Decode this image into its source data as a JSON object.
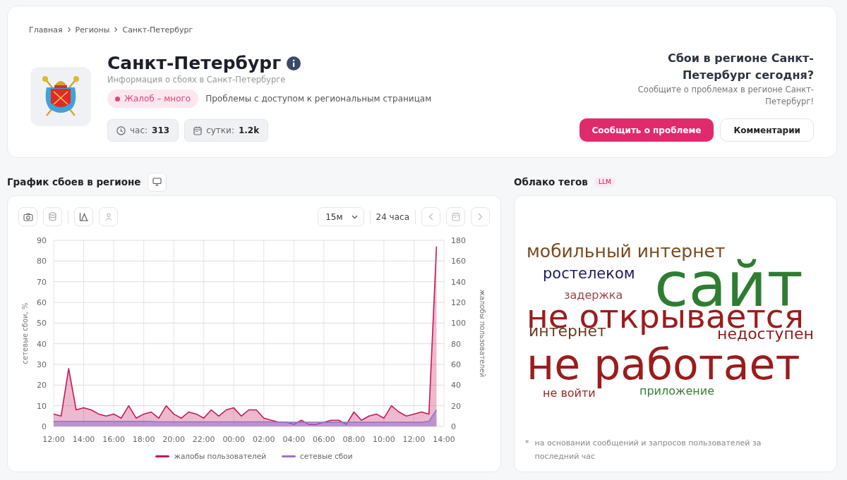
{
  "breadcrumbs": [
    {
      "label": "Главная"
    },
    {
      "label": "Регионы"
    },
    {
      "label": "Санкт-Петербург"
    }
  ],
  "region": {
    "title": "Санкт-Петербург",
    "subtitle": "Информация о сбоях в Санкт-Петербурге",
    "status": {
      "label": "Жалоб – много",
      "color": "#e0457b"
    },
    "status_text": "Проблемы с доступом к региональным страницам",
    "stats": [
      {
        "kind": "hour",
        "label": "час:",
        "value": "313"
      },
      {
        "kind": "day",
        "label": "сутки:",
        "value": "1.2k"
      }
    ]
  },
  "report": {
    "title": "Сбои в регионе Санкт-Петербург сегодня?",
    "text": "Сообщите о проблемах в регионе Санкт-Петербург!",
    "buttons": [
      {
        "kind": "primary",
        "label": "Сообщить о проблеме"
      },
      {
        "kind": "secondary",
        "label": "Комментарии"
      }
    ]
  },
  "chart_section": {
    "title": "График сбоев в регионе",
    "toolbar": {
      "interval": "15м",
      "period": "24 часа"
    },
    "chart_data": {
      "type": "area",
      "grid": true,
      "legend": "bottom",
      "ylabel": "сетевые сбои, %",
      "y2label": "жалобы пользователей",
      "categories": [
        "12:00",
        null,
        null,
        null,
        "14:00",
        null,
        null,
        null,
        "16:00",
        null,
        null,
        null,
        "18:00",
        null,
        null,
        null,
        "20:00",
        null,
        null,
        null,
        "22:00",
        null,
        null,
        null,
        "00:00",
        null,
        null,
        null,
        "02:00",
        null,
        null,
        null,
        "04:00",
        null,
        null,
        null,
        "06:00",
        null,
        null,
        null,
        "08:00",
        null,
        null,
        null,
        "10:00",
        null,
        null,
        null,
        "12:00",
        null,
        null,
        null,
        "14:00"
      ],
      "ylim": [
        0,
        90
      ],
      "yticks": [
        0,
        10,
        20,
        30,
        40,
        50,
        60,
        70,
        80,
        90
      ],
      "y2lim": [
        0,
        180
      ],
      "y2ticks": [
        0,
        20,
        40,
        60,
        80,
        100,
        120,
        140,
        160,
        180
      ],
      "series": [
        {
          "name": "жалобы пользователей",
          "color": "#c2185b",
          "axis": "y2",
          "values": [
            12,
            10,
            56,
            16,
            18,
            16,
            12,
            10,
            12,
            8,
            20,
            8,
            12,
            14,
            8,
            20,
            12,
            8,
            14,
            12,
            8,
            16,
            10,
            16,
            18,
            10,
            16,
            16,
            8,
            6,
            4,
            4,
            2,
            6,
            2,
            2,
            4,
            6,
            6,
            2,
            14,
            6,
            10,
            12,
            8,
            20,
            14,
            10,
            12,
            14,
            12,
            174,
            null
          ]
        },
        {
          "name": "сетевые сбои",
          "color": "#9575cd",
          "values": [
            2.5,
            2.5,
            2.5,
            2.5,
            2.5,
            2.5,
            2.5,
            2.5,
            2.5,
            2.5,
            2.5,
            2.5,
            2.5,
            2.5,
            2.2,
            2.2,
            2.2,
            2.2,
            2.2,
            2.2,
            2.2,
            2.2,
            2.2,
            2.2,
            2.2,
            2.2,
            2.2,
            2.2,
            2.2,
            2.2,
            2,
            2,
            2,
            2,
            2,
            2,
            2,
            2,
            2,
            2,
            2,
            2,
            2,
            2,
            2,
            2,
            2,
            2,
            2,
            2,
            2.5,
            8,
            null
          ]
        }
      ]
    }
  },
  "tag_cloud": {
    "title": "Облако тегов",
    "badge": "LLM",
    "tags": [
      {
        "text": "мобильный интернет",
        "color": "#7a4a1e"
      },
      {
        "text": "ростелеком",
        "color": "#1c1a5e"
      },
      {
        "text": "задержка",
        "color": "#a0464a"
      },
      {
        "text": "сайт",
        "color": "#2e7d32"
      },
      {
        "text": "не открывается",
        "color": "#9b1c1c"
      },
      {
        "text": "интернет",
        "color": "#6b3a1e"
      },
      {
        "text": "недоступен",
        "color": "#8b1a1a"
      },
      {
        "text": "не работает",
        "color": "#9b1c1c"
      },
      {
        "text": "не войти",
        "color": "#a02828"
      },
      {
        "text": "приложение",
        "color": "#3b7d3b"
      }
    ],
    "footnote_mark": "*",
    "footnote": "на основании сообщений и запросов пользователей за последний час"
  }
}
